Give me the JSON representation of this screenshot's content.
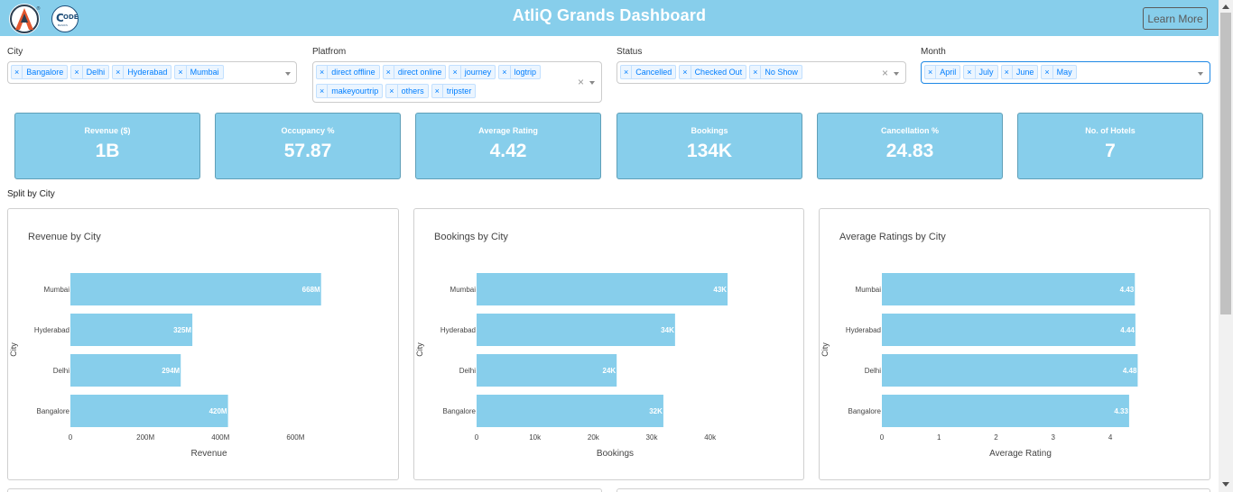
{
  "header": {
    "title": "AtliQ Grands Dashboard",
    "learn_more_label": "Learn More",
    "logo_cb_top": "ODE",
    "logo_cb_mid": "C",
    "logo_cb_bottom": "BASICS",
    "brand_color": "#87ceeb"
  },
  "filters": {
    "city": {
      "label": "City",
      "chips": [
        "Bangalore",
        "Delhi",
        "Hyderabad",
        "Mumbai"
      ]
    },
    "platform": {
      "label": "Platfrom",
      "chips": [
        "direct offline",
        "direct online",
        "journey",
        "logtrip",
        "makeyourtrip",
        "others",
        "tripster"
      ]
    },
    "status": {
      "label": "Status",
      "chips": [
        "Cancelled",
        "Checked Out",
        "No Show"
      ]
    },
    "month": {
      "label": "Month",
      "chips": [
        "April",
        "July",
        "June",
        "May"
      ]
    }
  },
  "kpis": [
    {
      "label": "Revenue ($)",
      "value": "1B"
    },
    {
      "label": "Occupancy %",
      "value": "57.87"
    },
    {
      "label": "Average Rating",
      "value": "4.42"
    },
    {
      "label": "Bookings",
      "value": "134K"
    },
    {
      "label": "Cancellation %",
      "value": "24.83"
    },
    {
      "label": "No. of Hotels",
      "value": "7"
    }
  ],
  "section_title": "Split by City",
  "chart_data": [
    {
      "type": "bar",
      "orientation": "horizontal",
      "title": "Revenue by City",
      "xlabel": "Revenue",
      "ylabel": "City",
      "categories": [
        "Mumbai",
        "Hyderabad",
        "Delhi",
        "Bangalore"
      ],
      "values": [
        668000000,
        325000000,
        294000000,
        420000000
      ],
      "data_labels": [
        "668M",
        "325M",
        "294M",
        "420M"
      ],
      "xlim": [
        0,
        700000000
      ],
      "xticks": [
        0,
        200000000,
        400000000,
        600000000
      ],
      "xtick_labels": [
        "0",
        "200M",
        "400M",
        "600M"
      ],
      "bar_color": "#87ceeb"
    },
    {
      "type": "bar",
      "orientation": "horizontal",
      "title": "Bookings by City",
      "xlabel": "Bookings",
      "ylabel": "City",
      "categories": [
        "Mumbai",
        "Hyderabad",
        "Delhi",
        "Bangalore"
      ],
      "values": [
        43000,
        34000,
        24000,
        32000
      ],
      "data_labels": [
        "43K",
        "34K",
        "24K",
        "32K"
      ],
      "xlim": [
        0,
        45000
      ],
      "xticks": [
        0,
        10000,
        20000,
        30000,
        40000
      ],
      "xtick_labels": [
        "0",
        "10k",
        "20k",
        "30k",
        "40k"
      ],
      "bar_color": "#87ceeb"
    },
    {
      "type": "bar",
      "orientation": "horizontal",
      "title": "Average Ratings by City",
      "xlabel": "Average Rating",
      "ylabel": "City",
      "categories": [
        "Mumbai",
        "Hyderabad",
        "Delhi",
        "Bangalore"
      ],
      "values": [
        4.43,
        4.44,
        4.48,
        4.33
      ],
      "data_labels": [
        "4.43",
        "4.44",
        "4.48",
        "4.33"
      ],
      "xlim": [
        0,
        4.6
      ],
      "xticks": [
        0,
        1,
        2,
        3,
        4
      ],
      "xtick_labels": [
        "0",
        "1",
        "2",
        "3",
        "4"
      ],
      "bar_color": "#87ceeb"
    }
  ]
}
